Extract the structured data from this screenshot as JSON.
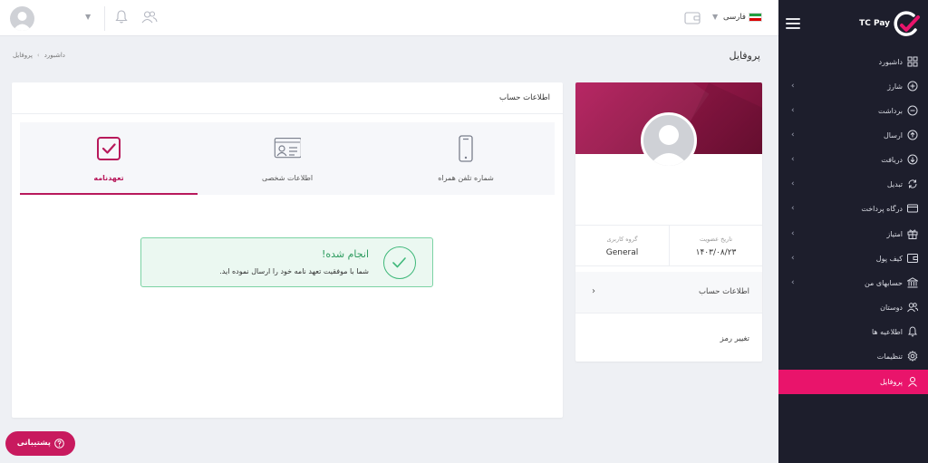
{
  "brand": {
    "name": "TC Pay",
    "accent": "#e9146b"
  },
  "sidebar": {
    "items": [
      {
        "label": "داشبورد",
        "icon": "grid-icon",
        "chevron": false
      },
      {
        "label": "شارژ",
        "icon": "plus-circle-icon",
        "chevron": true
      },
      {
        "label": "برداشت",
        "icon": "minus-circle-icon",
        "chevron": true
      },
      {
        "label": "ارسال",
        "icon": "arrow-up-circle-icon",
        "chevron": true
      },
      {
        "label": "دریافت",
        "icon": "arrow-down-circle-icon",
        "chevron": true
      },
      {
        "label": "تبدیل",
        "icon": "refresh-icon",
        "chevron": true
      },
      {
        "label": "درگاه پرداخت",
        "icon": "credit-card-icon",
        "chevron": true
      },
      {
        "label": "امتیاز",
        "icon": "gift-icon",
        "chevron": true
      },
      {
        "label": "کیف پول",
        "icon": "wallet-icon",
        "chevron": true
      },
      {
        "label": "حسابهای من",
        "icon": "bank-icon",
        "chevron": true
      },
      {
        "label": "دوستان",
        "icon": "users-icon",
        "chevron": false
      },
      {
        "label": "اطلاعیه ها",
        "icon": "bell-icon",
        "chevron": false
      },
      {
        "label": "تنظیمات",
        "icon": "gear-icon",
        "chevron": false
      },
      {
        "label": "پروفایل",
        "icon": "user-icon",
        "chevron": false,
        "active": true
      }
    ]
  },
  "header": {
    "language": "فارسی"
  },
  "page": {
    "title": "پروفایل",
    "breadcrumb": [
      "داشبورد",
      "پروفایل"
    ]
  },
  "profile_card": {
    "join_date_label": "تاریخ عضویت",
    "join_date": "۱۴۰۳/۰۸/۲۳",
    "group_label": "گروه کاربری",
    "group": "General",
    "menu": [
      "اطلاعات حساب",
      "تغییر رمز"
    ]
  },
  "account": {
    "title": "اطلاعات حساب",
    "steps": [
      {
        "label": "شماره تلفن همراه",
        "icon": "phone-icon"
      },
      {
        "label": "اطلاعات شخصی",
        "icon": "id-card-icon"
      },
      {
        "label": "تعهدنامه",
        "icon": "check-square-icon",
        "active": true
      }
    ],
    "success_title": "انجام شده!",
    "success_text": "شما با موفقیت تعهد نامه خود را ارسال نموده اید."
  },
  "support": {
    "label": "پشتیبانی"
  }
}
